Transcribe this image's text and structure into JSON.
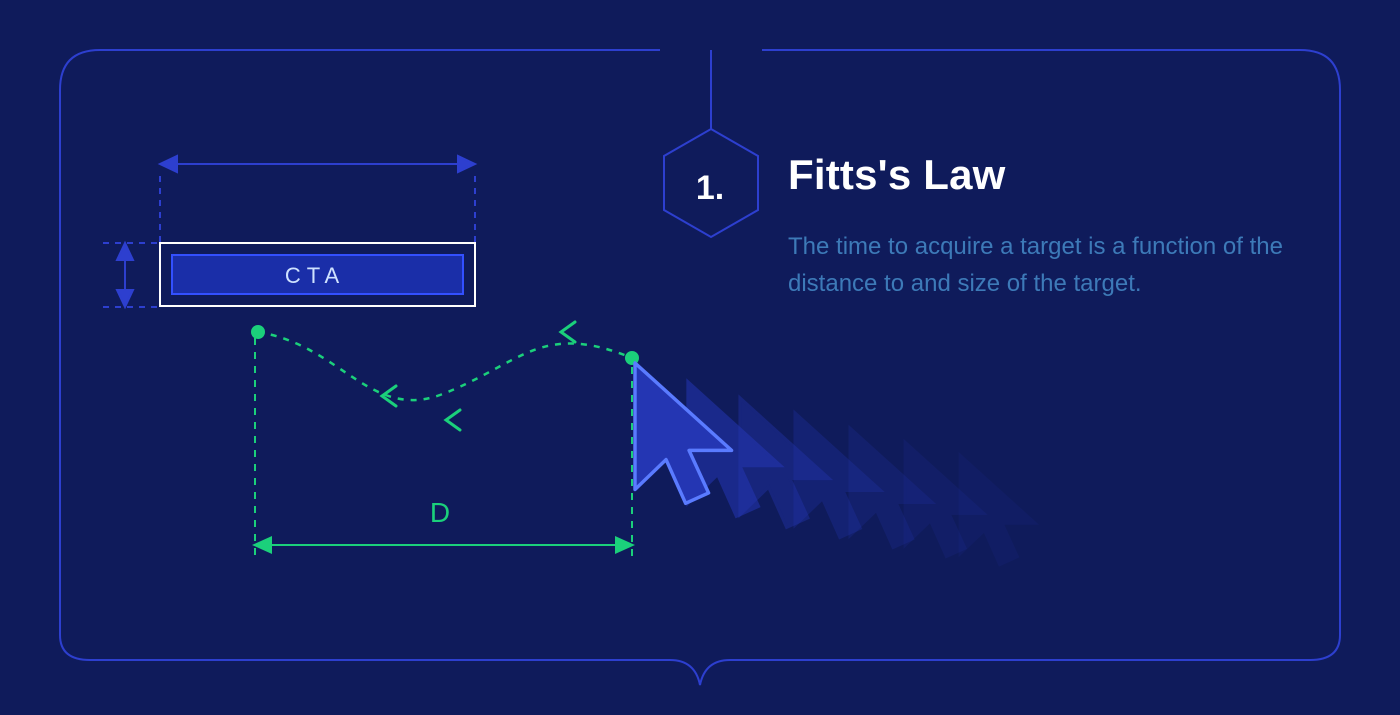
{
  "number": "1.",
  "title": "Fitts's Law",
  "description": "The time to acquire a target is a function of the distance to and size of the target.",
  "diagram": {
    "cta_label": "CTA",
    "distance_label": "D"
  },
  "colors": {
    "background": "#0f1b5b",
    "frame": "#2d3fcf",
    "white": "#ffffff",
    "desc": "#3d7ab8",
    "green": "#1bd07b",
    "cta_fill": "#1a2ea8",
    "cursor_fill": "#2436b3",
    "cursor_stroke": "#4a6bff"
  }
}
